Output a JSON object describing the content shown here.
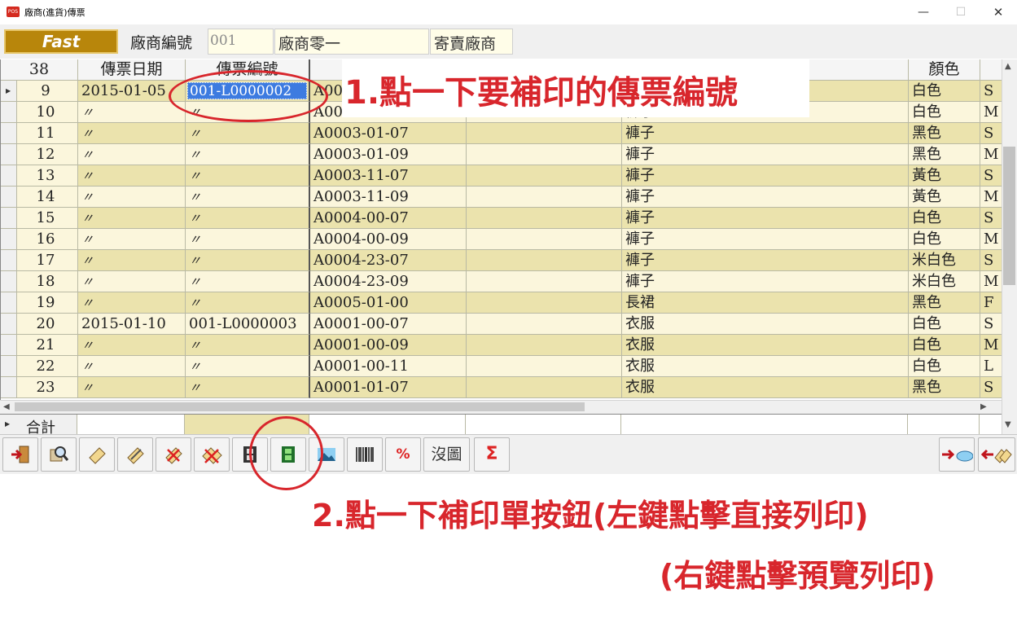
{
  "window": {
    "title": "廠商(進貨)傳票",
    "minimize": "—",
    "maximize": "☐",
    "close": "✕"
  },
  "form": {
    "fast_button": "Fast",
    "vendor_no_label": "廠商編號",
    "vendor_no_value": "001",
    "vendor_name": "廠商零一",
    "vendor_type": "寄賣廠商"
  },
  "grid": {
    "header": {
      "row_count": "38",
      "date": "傳票日期",
      "voucher_no": "傳票編號",
      "color": "顏色"
    },
    "rows": [
      {
        "no": "9",
        "date": "2015-01-05",
        "voucher": "001-L0000002",
        "code": "A00",
        "name": "",
        "color": "白色",
        "size": "S"
      },
      {
        "no": "10",
        "date": "〃",
        "voucher": "〃",
        "code": "A0003-00-09",
        "name": "褲子",
        "color": "白色",
        "size": "M"
      },
      {
        "no": "11",
        "date": "〃",
        "voucher": "〃",
        "code": "A0003-01-07",
        "name": "褲子",
        "color": "黑色",
        "size": "S"
      },
      {
        "no": "12",
        "date": "〃",
        "voucher": "〃",
        "code": "A0003-01-09",
        "name": "褲子",
        "color": "黑色",
        "size": "M"
      },
      {
        "no": "13",
        "date": "〃",
        "voucher": "〃",
        "code": "A0003-11-07",
        "name": "褲子",
        "color": "黃色",
        "size": "S"
      },
      {
        "no": "14",
        "date": "〃",
        "voucher": "〃",
        "code": "A0003-11-09",
        "name": "褲子",
        "color": "黃色",
        "size": "M"
      },
      {
        "no": "15",
        "date": "〃",
        "voucher": "〃",
        "code": "A0004-00-07",
        "name": "褲子",
        "color": "白色",
        "size": "S"
      },
      {
        "no": "16",
        "date": "〃",
        "voucher": "〃",
        "code": "A0004-00-09",
        "name": "褲子",
        "color": "白色",
        "size": "M"
      },
      {
        "no": "17",
        "date": "〃",
        "voucher": "〃",
        "code": "A0004-23-07",
        "name": "褲子",
        "color": "米白色",
        "size": "S"
      },
      {
        "no": "18",
        "date": "〃",
        "voucher": "〃",
        "code": "A0004-23-09",
        "name": "褲子",
        "color": "米白色",
        "size": "M"
      },
      {
        "no": "19",
        "date": "〃",
        "voucher": "〃",
        "code": "A0005-01-00",
        "name": "長裙",
        "color": "黑色",
        "size": "F"
      },
      {
        "no": "20",
        "date": "2015-01-10",
        "voucher": "001-L0000003",
        "code": "A0001-00-07",
        "name": "衣服",
        "color": "白色",
        "size": "S"
      },
      {
        "no": "21",
        "date": "〃",
        "voucher": "〃",
        "code": "A0001-00-09",
        "name": "衣服",
        "color": "白色",
        "size": "M"
      },
      {
        "no": "22",
        "date": "〃",
        "voucher": "〃",
        "code": "A0001-00-11",
        "name": "衣服",
        "color": "白色",
        "size": "L"
      },
      {
        "no": "23",
        "date": "〃",
        "voucher": "〃",
        "code": "A0001-01-07",
        "name": "衣服",
        "color": "黑色",
        "size": "S"
      }
    ],
    "total_label": "合計"
  },
  "toolbar": {
    "no_image": "沒圖",
    "percent": "%",
    "sigma": "Σ"
  },
  "annotations": {
    "step1": "1.點一下要補印的傳票編號",
    "step2": "2.點一下補印單按鈕(左鍵點擊直接列印)",
    "step3": "(右鍵點擊預覽列印)"
  },
  "colors": {
    "accent_red": "#d8262c",
    "fast_gold": "#b8860b",
    "row_light": "#fbf6dc",
    "row_dark": "#ebe3ad",
    "selection": "#3d7be0"
  }
}
